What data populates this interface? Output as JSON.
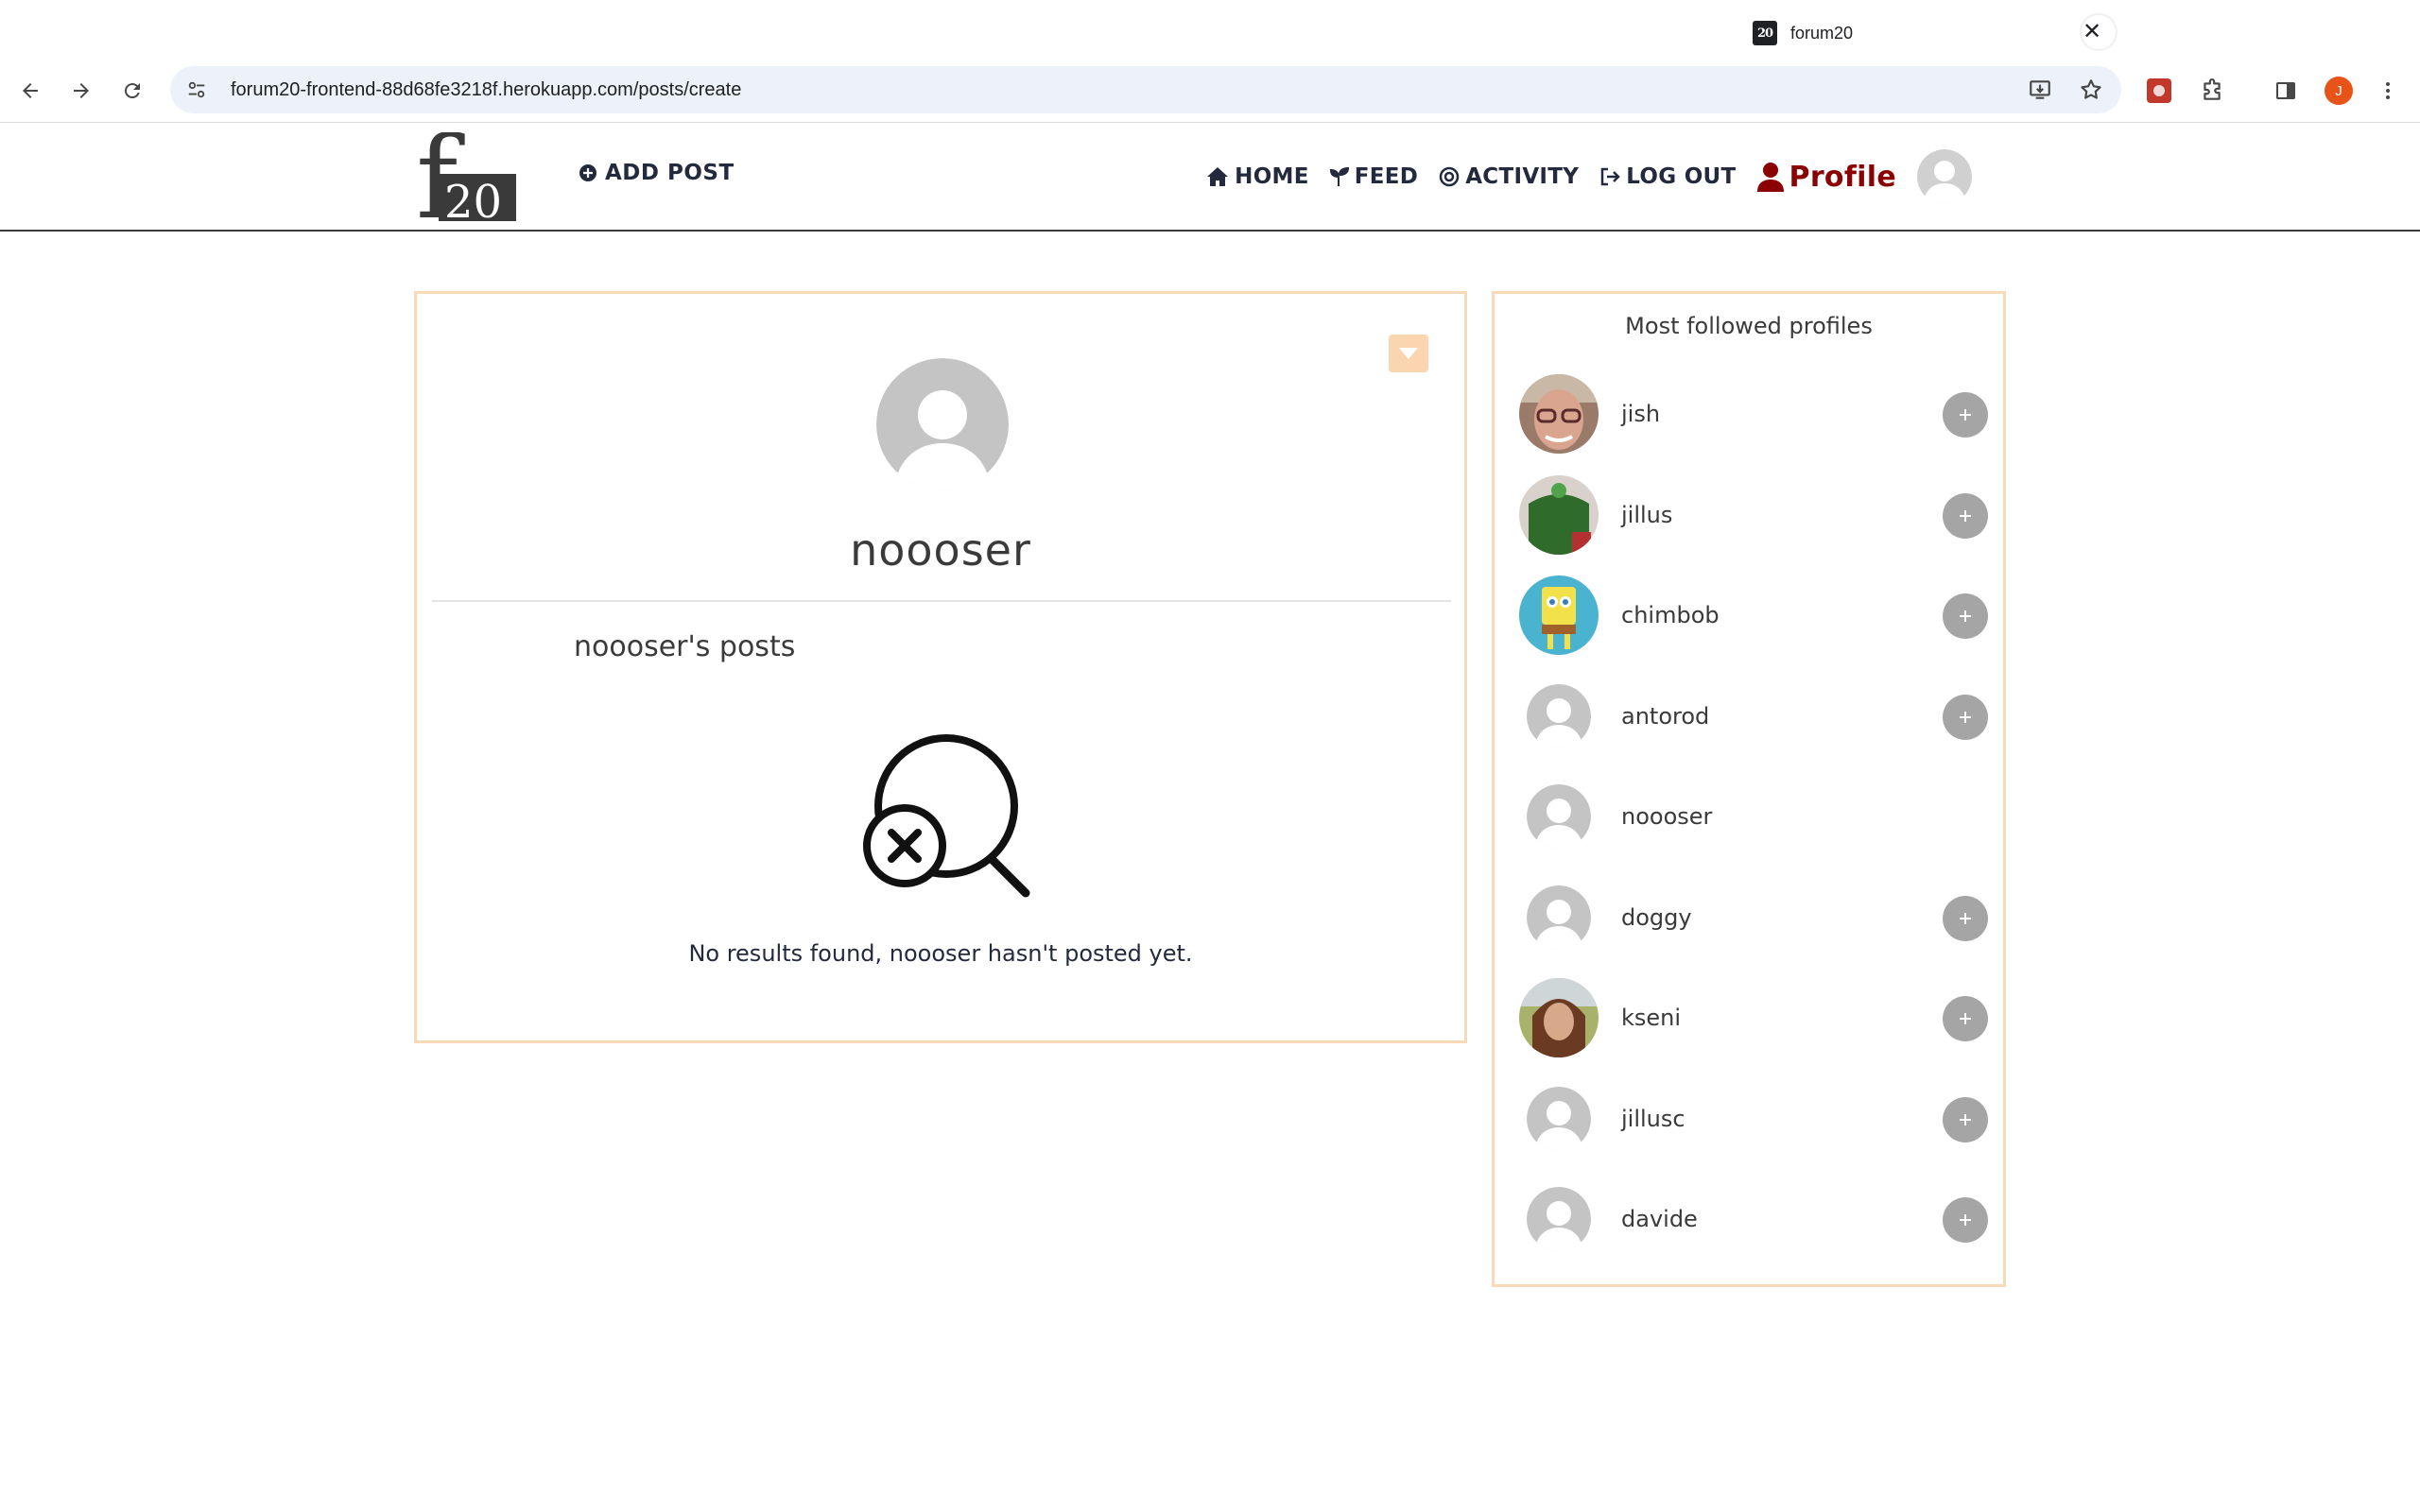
{
  "browser": {
    "tab_title": "forum20",
    "tab_favicon_text": "20",
    "url": "forum20-frontend-88d68fe3218f.herokuapp.com/posts/create",
    "profile_initial": "J"
  },
  "navbar": {
    "logo_text_f": "f",
    "logo_text_num": "20",
    "add_post": "ADD POST",
    "links": {
      "home": "HOME",
      "feed": "FEED",
      "activity": "ACTIVITY",
      "logout": "LOG OUT",
      "profile": "Profile"
    }
  },
  "profile": {
    "username": "noooser",
    "posts_heading": "noooser's posts",
    "empty_message": "No results found, noooser hasn't posted yet."
  },
  "sidebar": {
    "title": "Most followed profiles",
    "profiles": [
      {
        "name": "jish",
        "avatar": "photo-man-glasses",
        "followable": true
      },
      {
        "name": "jillus",
        "avatar": "photo-green-shirt",
        "followable": true
      },
      {
        "name": "chimbob",
        "avatar": "photo-spongebob",
        "followable": true
      },
      {
        "name": "antorod",
        "avatar": "default-avatar",
        "followable": true
      },
      {
        "name": "noooser",
        "avatar": "default-avatar",
        "followable": false
      },
      {
        "name": "doggy",
        "avatar": "default-avatar",
        "followable": true
      },
      {
        "name": "kseni",
        "avatar": "photo-woman-outdoor",
        "followable": true
      },
      {
        "name": "jillusc",
        "avatar": "default-avatar",
        "followable": true
      },
      {
        "name": "davide",
        "avatar": "default-avatar",
        "followable": true
      }
    ]
  },
  "colors": {
    "accent_border": "#f8d9b8",
    "profile_link": "#8b0000",
    "text_dark": "#242a3d",
    "follow_button": "#a5a5a5"
  }
}
